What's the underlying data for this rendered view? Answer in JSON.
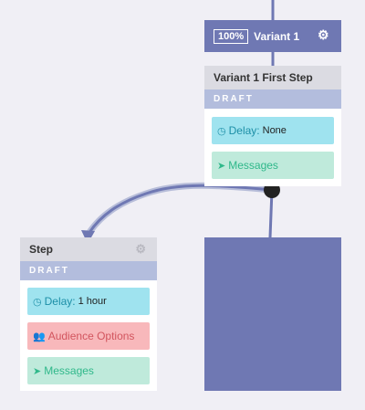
{
  "variant": {
    "percentage": "100%",
    "name": "Variant 1"
  },
  "variant_step": {
    "title": "Variant 1 First Step",
    "status": "DRAFT",
    "delay_label": "Delay:",
    "delay_value": "None",
    "messages_label": "Messages"
  },
  "new_step": {
    "title": "Step",
    "status": "DRAFT",
    "delay_label": "Delay:",
    "delay_value": "1 hour",
    "audience_label": "Audience Options",
    "messages_label": "Messages"
  },
  "colors": {
    "variant_header": "#6f78b3",
    "status_bar": "#b3bddd",
    "delay_pill": "#9fe3ef",
    "messages_pill": "#bfeadb",
    "audience_pill": "#f8b8bb",
    "connector": "#6f78b3",
    "handle": "#222222"
  },
  "icons": [
    "gear-icon",
    "clock-icon",
    "paper-plane-icon",
    "users-icon",
    "connector-handle"
  ]
}
